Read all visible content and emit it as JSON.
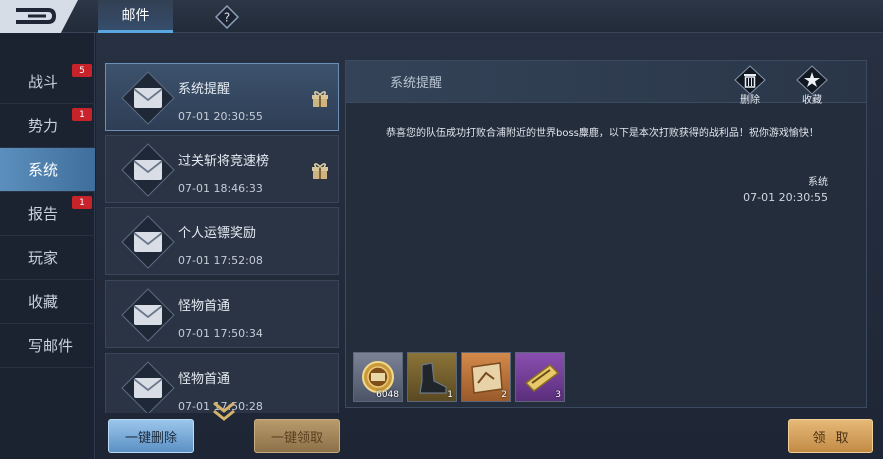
{
  "header": {
    "tab_label": "邮件",
    "help_icon": "question-icon",
    "back_icon": "back-arrow-icon"
  },
  "sidebar": {
    "items": [
      {
        "label": "战斗",
        "badge": "5"
      },
      {
        "label": "势力",
        "badge": "1"
      },
      {
        "label": "系统",
        "badge": ""
      },
      {
        "label": "报告",
        "badge": "1"
      },
      {
        "label": "玩家",
        "badge": ""
      },
      {
        "label": "收藏",
        "badge": ""
      },
      {
        "label": "写邮件",
        "badge": ""
      }
    ],
    "active_index": 2
  },
  "mails": [
    {
      "title": "系统提醒",
      "time": "07-01 20:30:55",
      "has_gift": true,
      "selected": true
    },
    {
      "title": "过关斩将竞速榜",
      "time": "07-01 18:46:33",
      "has_gift": true,
      "selected": false
    },
    {
      "title": "个人运镖奖励",
      "time": "07-01 17:52:08",
      "has_gift": false,
      "selected": false
    },
    {
      "title": "怪物首通",
      "time": "07-01 17:50:34",
      "has_gift": false,
      "selected": false
    },
    {
      "title": "怪物首通",
      "time": "07-01 17:50:28",
      "has_gift": false,
      "selected": false
    }
  ],
  "detail": {
    "title": "系统提醒",
    "delete_label": "删除",
    "favorite_label": "收藏",
    "body": "恭喜您的队伍成功打败合浦附近的世界boss麋鹿，以下是本次打败获得的战利品！祝你游戏愉快！",
    "sender": "系统",
    "time": "07-01 20:30:55",
    "rewards": [
      {
        "icon": "coin-medal-icon",
        "count": "6048"
      },
      {
        "icon": "boot-icon",
        "count": "1"
      },
      {
        "icon": "scroll-map-icon",
        "count": "2"
      },
      {
        "icon": "book-icon",
        "count": "3"
      }
    ]
  },
  "buttons": {
    "delete_all": "一键删除",
    "claim_all": "一键领取",
    "claim": "领取"
  },
  "colors": {
    "accent_blue": "#5aa7e0",
    "badge_red": "#c8222a",
    "gold": "#e6b977"
  }
}
